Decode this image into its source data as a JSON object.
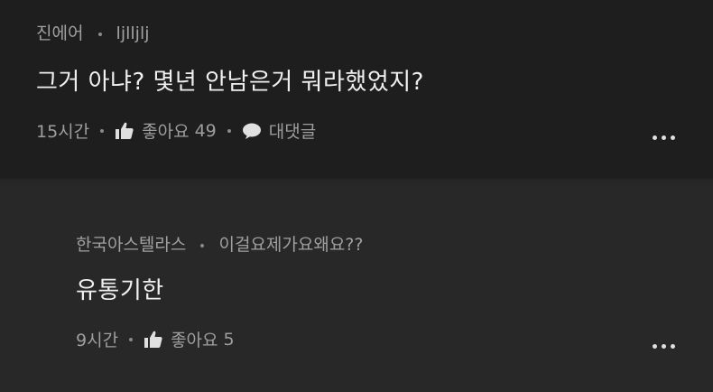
{
  "comments": [
    {
      "author": "진에어",
      "user_id": "ljlljlj",
      "text": "그거 아냐? 몇년 안남은거 뭐라했었지?",
      "time": "15시간",
      "like_label": "좋아요",
      "like_count": "49",
      "reply_label": "대댓글"
    },
    {
      "author": "한국아스텔라스",
      "user_id": "이걸요제가요왜요??",
      "text": "유통기한",
      "time": "9시간",
      "like_label": "좋아요",
      "like_count": "5"
    }
  ],
  "icons": {
    "like": "thumbs-up-icon",
    "reply": "speech-bubble-icon",
    "more": "more-horizontal-icon"
  },
  "colors": {
    "background": "#1e1e1e",
    "reply_background": "#282828",
    "text": "#f0f0f0",
    "muted": "#a0a0a0"
  }
}
